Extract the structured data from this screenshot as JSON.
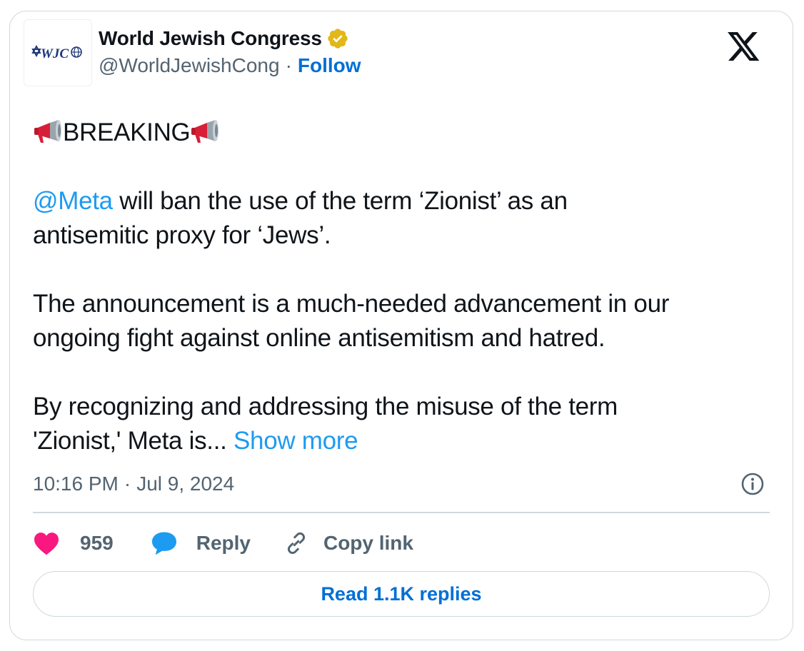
{
  "author": {
    "name": "World Jewish Congress",
    "avatar_text": "WJC",
    "handle": "@WorldJewishCong",
    "separator": "·",
    "follow_label": "Follow",
    "verified_icon": "verified-badge-gold"
  },
  "platform_icon": "x-logo",
  "tweet": {
    "breaking_text": "BREAKING",
    "breaking_icon": "megaphone-emoji",
    "mention": "@Meta",
    "line1_rest": " will ban the use of the term ‘Zionist’ as an",
    "line1_cont": "antisemitic proxy for ‘Jews’.",
    "para2_line1": "The announcement is a much-needed advancement in our",
    "para2_line2": "ongoing fight against online antisemitism and hatred.",
    "para3_line1": "By recognizing and addressing the misuse of the term",
    "para3_line2": "'Zionist,' Meta is... ",
    "show_more": "Show more"
  },
  "meta": {
    "time": "10:16 PM",
    "separator": "·",
    "date": "Jul 9, 2024",
    "info_icon": "info-icon"
  },
  "actions": {
    "like_count": "959",
    "reply_label": "Reply",
    "copy_link_label": "Copy link"
  },
  "read_replies_label": "Read 1.1K replies",
  "colors": {
    "accent_link": "#1d9bf0",
    "follow_blue": "#006fd6",
    "like_pink": "#f91880",
    "reply_blue": "#1d9bf0",
    "muted_text": "#536471",
    "border": "#cfd9de",
    "verified_gold": "#e2b719"
  }
}
